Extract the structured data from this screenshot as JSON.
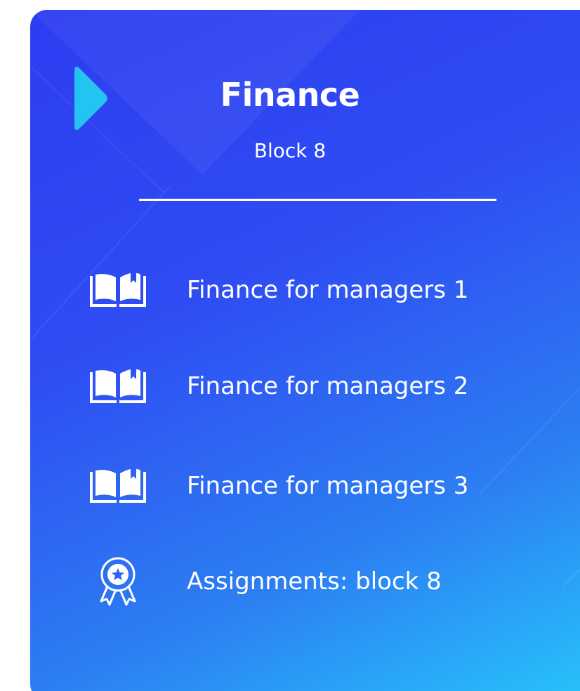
{
  "course": {
    "title": "Finance",
    "subtitle": "Block 8"
  },
  "items": [
    {
      "label": "Finance for managers 1",
      "icon": "open-book-icon"
    },
    {
      "label": "Finance for managers 2",
      "icon": "open-book-icon"
    },
    {
      "label": "Finance for managers 3",
      "icon": "open-book-icon"
    },
    {
      "label": "Assignments: block 8",
      "icon": "award-ribbon-icon"
    }
  ],
  "colors": {
    "gradient_start": "#2c3df2",
    "gradient_end": "#27c4fb",
    "marker": "#23c3f2",
    "text": "#ffffff"
  }
}
